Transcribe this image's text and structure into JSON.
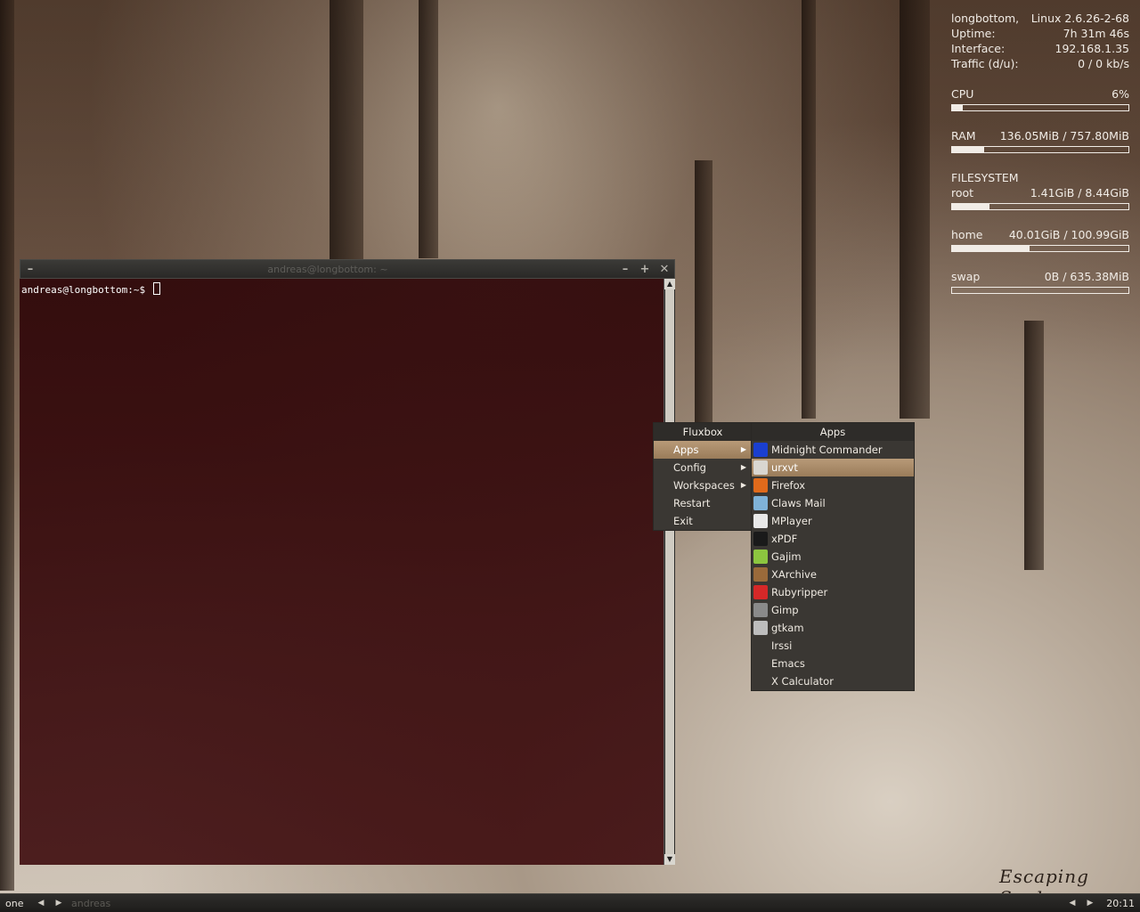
{
  "conky": {
    "hostname": "longbottom,",
    "kernel": "Linux 2.6.26-2-68",
    "uptime_label": "Uptime:",
    "uptime_value": "7h 31m 46s",
    "interface_label": "Interface:",
    "interface_value": "192.168.1.35",
    "traffic_label": "Traffic (d/u):",
    "traffic_value": "0 / 0 kb/s",
    "cpu_label": "CPU",
    "cpu_value": "6%",
    "cpu_fraction": 0.06,
    "ram_label": "RAM",
    "ram_value": "136.05MiB / 757.80MiB",
    "ram_fraction": 0.18,
    "fs_heading": "FILESYSTEM",
    "root_label": "root",
    "root_value": "1.41GiB / 8.44GiB",
    "root_fraction": 0.21,
    "home_label": "home",
    "home_value": "40.01GiB / 100.99GiB",
    "home_fraction": 0.44,
    "swap_label": "swap",
    "swap_value": "0B / 635.38MiB",
    "swap_fraction": 0.0
  },
  "terminal": {
    "title": "andreas@longbottom: ~",
    "prompt": "andreas@longbottom:~$",
    "minimize_glyph": "–",
    "maximize_glyph": "+",
    "close_glyph": "✕",
    "menu_glyph": "–"
  },
  "root_menu": {
    "title": "Fluxbox",
    "items": [
      {
        "label": "Apps",
        "submenu": true
      },
      {
        "label": "Config",
        "submenu": true
      },
      {
        "label": "Workspaces",
        "submenu": true
      },
      {
        "label": "Restart",
        "submenu": false
      },
      {
        "label": "Exit",
        "submenu": false
      }
    ]
  },
  "apps_menu": {
    "title": "Apps",
    "items": [
      {
        "label": "Midnight Commander",
        "icon": "midnight-commander-icon",
        "color": "#1a3fd0"
      },
      {
        "label": "urxvt",
        "icon": "terminal-icon",
        "color": "#d9d6d0"
      },
      {
        "label": "Firefox",
        "icon": "firefox-icon",
        "color": "#e06a1b"
      },
      {
        "label": "Claws Mail",
        "icon": "claws-mail-icon",
        "color": "#7fb2d8"
      },
      {
        "label": "MPlayer",
        "icon": "mplayer-icon",
        "color": "#e8e8e8"
      },
      {
        "label": "xPDF",
        "icon": "xpdf-icon",
        "color": "#1a1a1a"
      },
      {
        "label": "Gajim",
        "icon": "gajim-icon",
        "color": "#8cc63f"
      },
      {
        "label": "XArchive",
        "icon": "xarchive-icon",
        "color": "#9a6a3a"
      },
      {
        "label": "Rubyripper",
        "icon": "rubyripper-icon",
        "color": "#d62828"
      },
      {
        "label": "Gimp",
        "icon": "gimp-icon",
        "color": "#8a8a8a"
      },
      {
        "label": "gtkam",
        "icon": "gtkam-icon",
        "color": "#bdbdbd"
      },
      {
        "label": "Irssi",
        "icon": "",
        "color": ""
      },
      {
        "label": "Emacs",
        "icon": "",
        "color": ""
      },
      {
        "label": "X Calculator",
        "icon": "",
        "color": ""
      }
    ],
    "active_index": 1
  },
  "taskbar": {
    "workspace": "one",
    "prev_glyph": "◀",
    "next_glyph": "▶",
    "task": "andreas",
    "clock": "20:11"
  },
  "wallpaper": {
    "signature": "Escaping Souls"
  }
}
